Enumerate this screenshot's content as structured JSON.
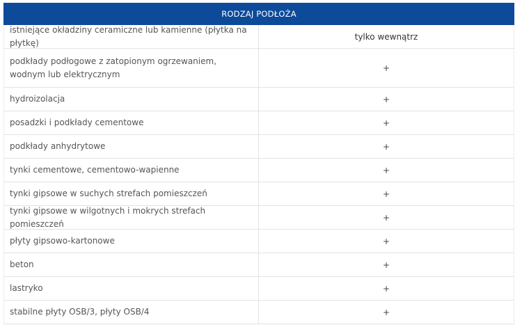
{
  "table": {
    "header": "RODZAJ PODŁOŻA",
    "rows": [
      {
        "label": "istniejące okładziny ceramiczne lub kamienne (płytka na płytkę)",
        "value": "tylko wewnątrz"
      },
      {
        "label": "podkłady podłogowe  z zatopionym ogrzewaniem, wodnym lub elektrycznym",
        "value": "+"
      },
      {
        "label": "hydroizolacja",
        "value": "+"
      },
      {
        "label": "posadzki i podkłady cementowe",
        "value": "+"
      },
      {
        "label": "podkłady anhydrytowe",
        "value": "+"
      },
      {
        "label": "tynki cementowe, cementowo-wapienne",
        "value": "+"
      },
      {
        "label": "tynki  gipsowe w suchych strefach pomieszczeń",
        "value": "+"
      },
      {
        "label": "tynki  gipsowe w wilgotnych i mokrych strefach pomieszczeń",
        "value": "+"
      },
      {
        "label": "płyty gipsowo-kartonowe",
        "value": "+"
      },
      {
        "label": "beton",
        "value": "+"
      },
      {
        "label": "lastryko",
        "value": "+"
      },
      {
        "label": "stabilne płyty OSB/3, płyty OSB/4",
        "value": "+"
      }
    ]
  }
}
